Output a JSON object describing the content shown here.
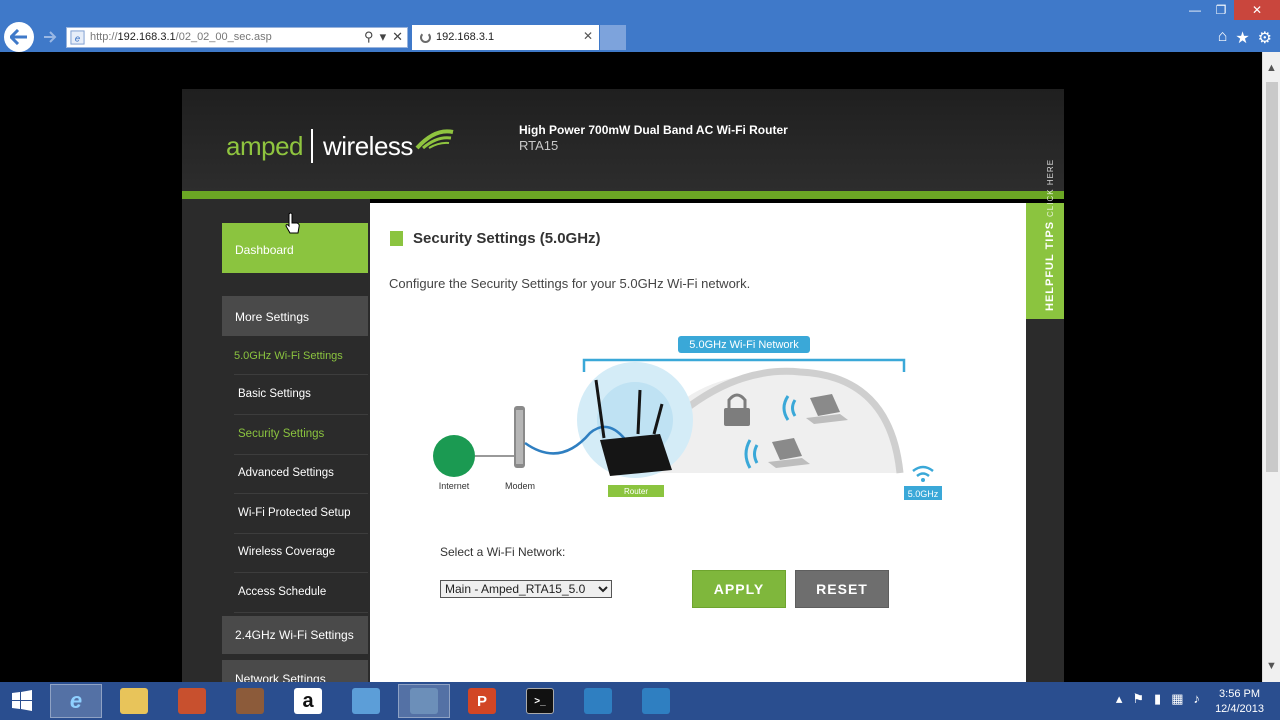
{
  "browser": {
    "address_prefix": "http://",
    "address_host": "192.168.3.1",
    "address_path": "/02_02_00_sec.asp",
    "tab_title": "192.168.3.1",
    "window_controls": {
      "minimize": "—",
      "maximize": "❐",
      "close": "✕"
    },
    "tools": {
      "home": "⌂",
      "favorites": "★",
      "settings": "⚙"
    }
  },
  "header": {
    "brand_left": "amped",
    "brand_right": "wireless",
    "product_name": "High Power 700mW Dual Band AC Wi-Fi Router",
    "product_model": "RTA15"
  },
  "sidebar": {
    "dashboard": "Dashboard",
    "more_settings": "More Settings",
    "section_50": "5.0GHz Wi-Fi Settings",
    "items": [
      {
        "label": "Basic Settings",
        "active": false
      },
      {
        "label": "Security Settings",
        "active": true
      },
      {
        "label": "Advanced Settings",
        "active": false
      },
      {
        "label": "Wi-Fi Protected Setup",
        "active": false
      },
      {
        "label": "Wireless Coverage",
        "active": false
      },
      {
        "label": "Access Schedule",
        "active": false
      }
    ],
    "section_24": "2.4GHz Wi-Fi Settings",
    "section_net": "Network Settings"
  },
  "main": {
    "title": "Security Settings (5.0GHz)",
    "description": "Configure the Security Settings for your 5.0GHz Wi-Fi network.",
    "diagram": {
      "network_label": "5.0GHz Wi-Fi Network",
      "internet": "Internet",
      "modem": "Modem",
      "router": "Router",
      "band": "5.0GHz"
    },
    "select_label": "Select a Wi-Fi Network:",
    "select_value": "Main - Amped_RTA15_5.0",
    "apply": "APPLY",
    "reset": "RESET"
  },
  "tips": {
    "label": "HELPFUL TIPS",
    "sub": "CLICK HERE"
  },
  "taskbar": {
    "time": "3:56 PM",
    "date": "12/4/2013"
  },
  "colors": {
    "brand_green": "#8bc43f",
    "teal": "#3aa8d8",
    "taskbar": "#2a4e8f"
  }
}
